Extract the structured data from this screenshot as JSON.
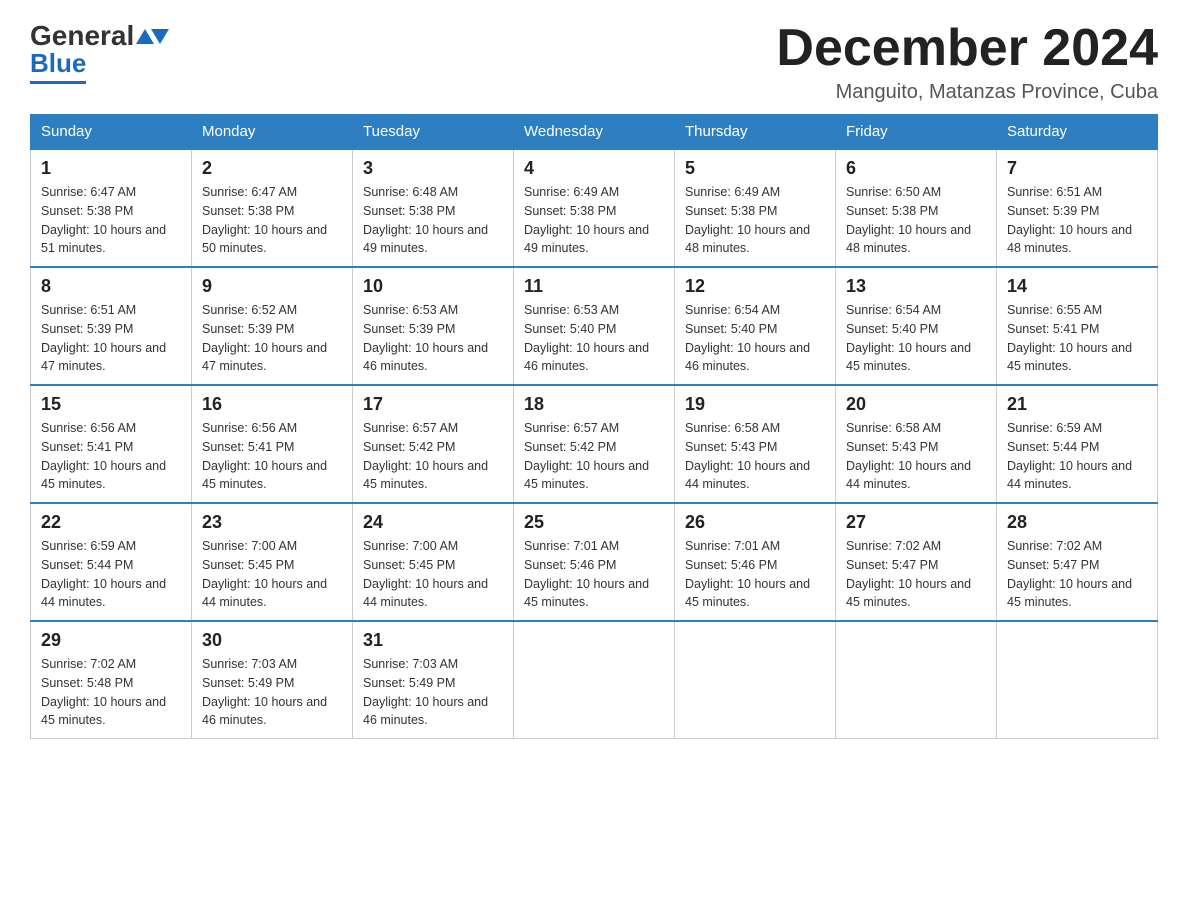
{
  "header": {
    "logo": {
      "general": "General",
      "blue": "Blue"
    },
    "title": "December 2024",
    "location": "Manguito, Matanzas Province, Cuba"
  },
  "days_of_week": [
    "Sunday",
    "Monday",
    "Tuesday",
    "Wednesday",
    "Thursday",
    "Friday",
    "Saturday"
  ],
  "weeks": [
    [
      {
        "day": "1",
        "sunrise": "6:47 AM",
        "sunset": "5:38 PM",
        "daylight": "10 hours and 51 minutes."
      },
      {
        "day": "2",
        "sunrise": "6:47 AM",
        "sunset": "5:38 PM",
        "daylight": "10 hours and 50 minutes."
      },
      {
        "day": "3",
        "sunrise": "6:48 AM",
        "sunset": "5:38 PM",
        "daylight": "10 hours and 49 minutes."
      },
      {
        "day": "4",
        "sunrise": "6:49 AM",
        "sunset": "5:38 PM",
        "daylight": "10 hours and 49 minutes."
      },
      {
        "day": "5",
        "sunrise": "6:49 AM",
        "sunset": "5:38 PM",
        "daylight": "10 hours and 48 minutes."
      },
      {
        "day": "6",
        "sunrise": "6:50 AM",
        "sunset": "5:38 PM",
        "daylight": "10 hours and 48 minutes."
      },
      {
        "day": "7",
        "sunrise": "6:51 AM",
        "sunset": "5:39 PM",
        "daylight": "10 hours and 48 minutes."
      }
    ],
    [
      {
        "day": "8",
        "sunrise": "6:51 AM",
        "sunset": "5:39 PM",
        "daylight": "10 hours and 47 minutes."
      },
      {
        "day": "9",
        "sunrise": "6:52 AM",
        "sunset": "5:39 PM",
        "daylight": "10 hours and 47 minutes."
      },
      {
        "day": "10",
        "sunrise": "6:53 AM",
        "sunset": "5:39 PM",
        "daylight": "10 hours and 46 minutes."
      },
      {
        "day": "11",
        "sunrise": "6:53 AM",
        "sunset": "5:40 PM",
        "daylight": "10 hours and 46 minutes."
      },
      {
        "day": "12",
        "sunrise": "6:54 AM",
        "sunset": "5:40 PM",
        "daylight": "10 hours and 46 minutes."
      },
      {
        "day": "13",
        "sunrise": "6:54 AM",
        "sunset": "5:40 PM",
        "daylight": "10 hours and 45 minutes."
      },
      {
        "day": "14",
        "sunrise": "6:55 AM",
        "sunset": "5:41 PM",
        "daylight": "10 hours and 45 minutes."
      }
    ],
    [
      {
        "day": "15",
        "sunrise": "6:56 AM",
        "sunset": "5:41 PM",
        "daylight": "10 hours and 45 minutes."
      },
      {
        "day": "16",
        "sunrise": "6:56 AM",
        "sunset": "5:41 PM",
        "daylight": "10 hours and 45 minutes."
      },
      {
        "day": "17",
        "sunrise": "6:57 AM",
        "sunset": "5:42 PM",
        "daylight": "10 hours and 45 minutes."
      },
      {
        "day": "18",
        "sunrise": "6:57 AM",
        "sunset": "5:42 PM",
        "daylight": "10 hours and 45 minutes."
      },
      {
        "day": "19",
        "sunrise": "6:58 AM",
        "sunset": "5:43 PM",
        "daylight": "10 hours and 44 minutes."
      },
      {
        "day": "20",
        "sunrise": "6:58 AM",
        "sunset": "5:43 PM",
        "daylight": "10 hours and 44 minutes."
      },
      {
        "day": "21",
        "sunrise": "6:59 AM",
        "sunset": "5:44 PM",
        "daylight": "10 hours and 44 minutes."
      }
    ],
    [
      {
        "day": "22",
        "sunrise": "6:59 AM",
        "sunset": "5:44 PM",
        "daylight": "10 hours and 44 minutes."
      },
      {
        "day": "23",
        "sunrise": "7:00 AM",
        "sunset": "5:45 PM",
        "daylight": "10 hours and 44 minutes."
      },
      {
        "day": "24",
        "sunrise": "7:00 AM",
        "sunset": "5:45 PM",
        "daylight": "10 hours and 44 minutes."
      },
      {
        "day": "25",
        "sunrise": "7:01 AM",
        "sunset": "5:46 PM",
        "daylight": "10 hours and 45 minutes."
      },
      {
        "day": "26",
        "sunrise": "7:01 AM",
        "sunset": "5:46 PM",
        "daylight": "10 hours and 45 minutes."
      },
      {
        "day": "27",
        "sunrise": "7:02 AM",
        "sunset": "5:47 PM",
        "daylight": "10 hours and 45 minutes."
      },
      {
        "day": "28",
        "sunrise": "7:02 AM",
        "sunset": "5:47 PM",
        "daylight": "10 hours and 45 minutes."
      }
    ],
    [
      {
        "day": "29",
        "sunrise": "7:02 AM",
        "sunset": "5:48 PM",
        "daylight": "10 hours and 45 minutes."
      },
      {
        "day": "30",
        "sunrise": "7:03 AM",
        "sunset": "5:49 PM",
        "daylight": "10 hours and 46 minutes."
      },
      {
        "day": "31",
        "sunrise": "7:03 AM",
        "sunset": "5:49 PM",
        "daylight": "10 hours and 46 minutes."
      },
      null,
      null,
      null,
      null
    ]
  ],
  "labels": {
    "sunrise": "Sunrise:",
    "sunset": "Sunset:",
    "daylight": "Daylight:"
  }
}
